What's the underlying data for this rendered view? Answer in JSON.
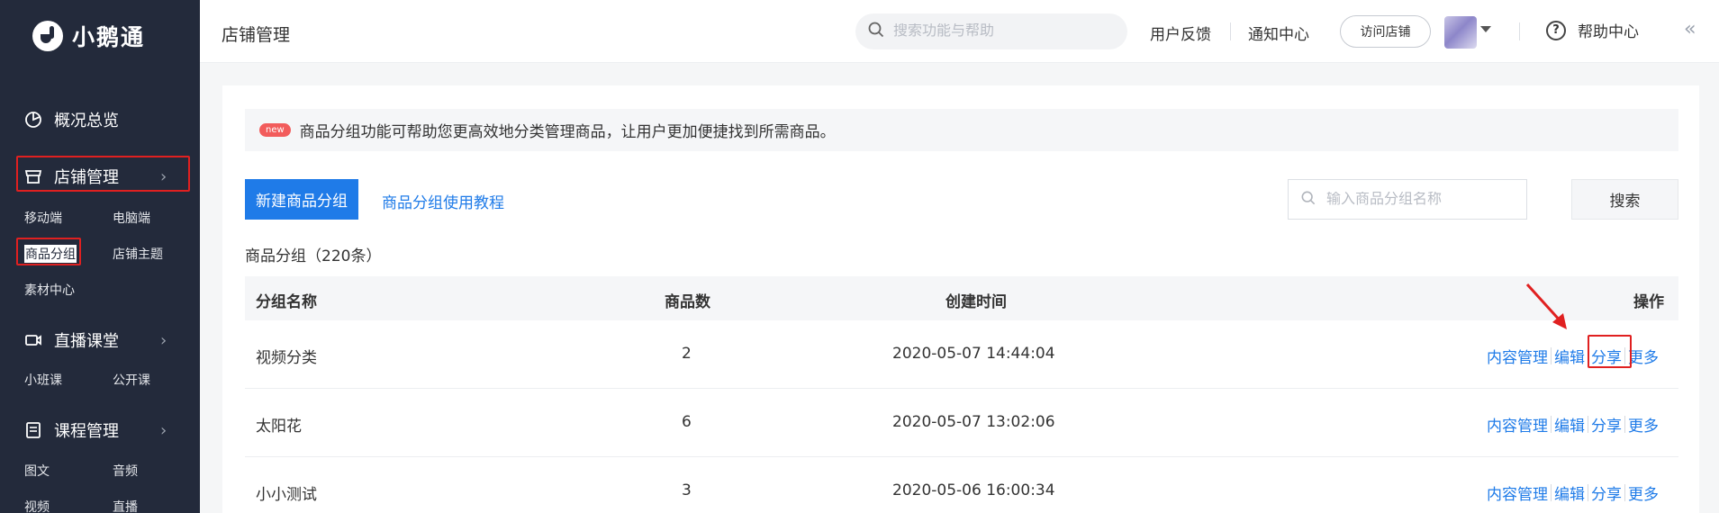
{
  "brand": {
    "name": "小鹅通"
  },
  "sidebar": {
    "overview": "概况总览",
    "store": {
      "label": "店铺管理",
      "subs": [
        "移动端",
        "电脑端",
        "商品分组",
        "店铺主题",
        "素材中心"
      ]
    },
    "live": {
      "label": "直播课堂",
      "subs": [
        "小班课",
        "公开课"
      ]
    },
    "course": {
      "label": "课程管理",
      "subs": [
        "图文",
        "音频",
        "视频",
        "直播"
      ]
    }
  },
  "topbar": {
    "title": "店铺管理",
    "search_placeholder": "搜索功能与帮助",
    "feedback": "用户反馈",
    "notifications": "通知中心",
    "visit_store": "访问店铺",
    "help": "帮助中心"
  },
  "main": {
    "notice_badge": "new",
    "notice_text": "商品分组功能可帮助您更高效地分类管理商品，让用户更加便捷找到所需商品。",
    "new_group_button": "新建商品分组",
    "tutorial_link": "商品分组使用教程",
    "search_placeholder": "输入商品分组名称",
    "search_button": "搜索",
    "count_label": "商品分组（220条）",
    "table": {
      "headers": [
        "分组名称",
        "商品数",
        "创建时间",
        "操作"
      ],
      "rows": [
        {
          "name": "视频分类",
          "count": "2",
          "created": "2020-05-07 14:44:04"
        },
        {
          "name": "太阳花",
          "count": "6",
          "created": "2020-05-07 13:02:06"
        },
        {
          "name": "小小测试",
          "count": "3",
          "created": "2020-05-06 16:00:34"
        }
      ],
      "actions": [
        "内容管理",
        "编辑",
        "分享",
        "更多"
      ]
    }
  },
  "colors": {
    "sidebar_bg": "#232a3b",
    "primary": "#1f7be8",
    "highlight": "#e02020",
    "new_badge": "#f25c5c"
  }
}
